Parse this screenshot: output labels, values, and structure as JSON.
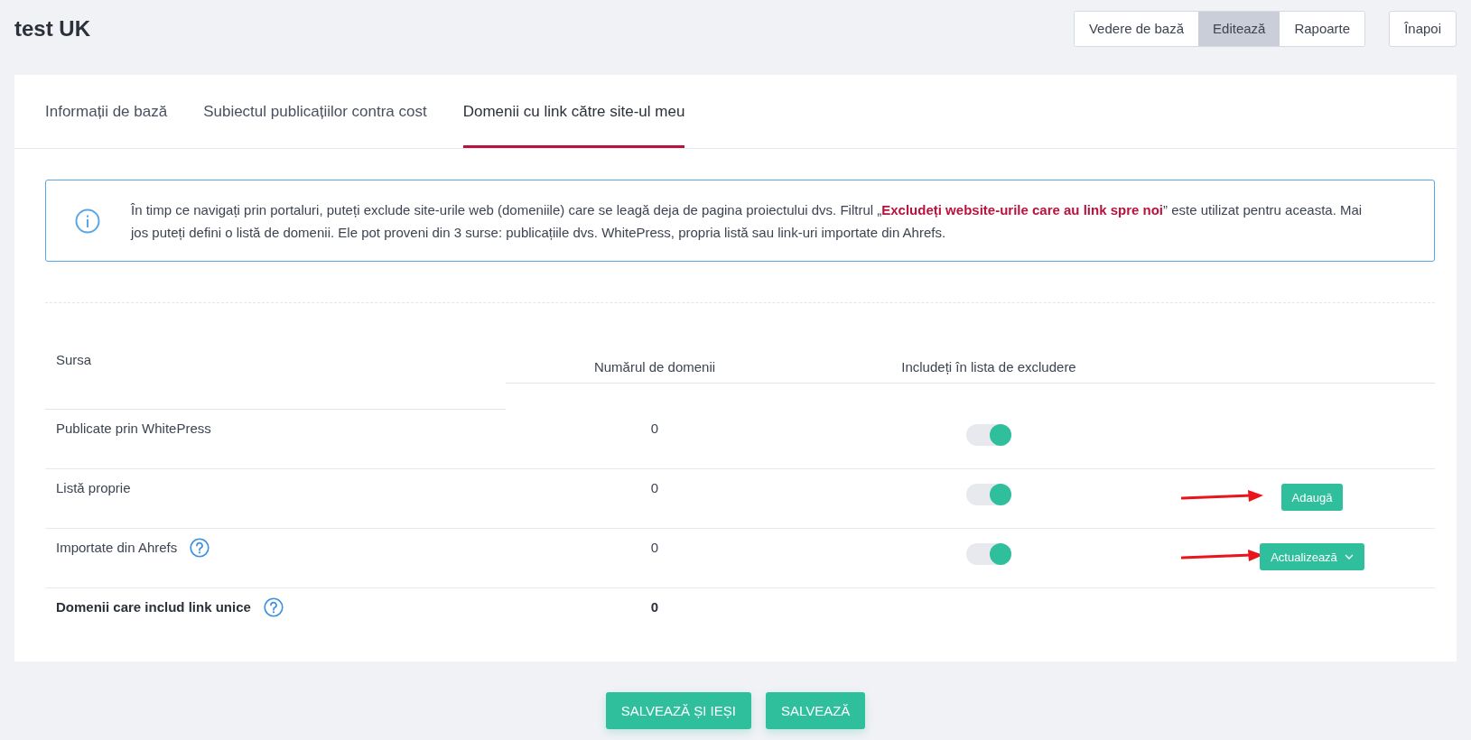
{
  "page": {
    "title": "test UK"
  },
  "view_switch": [
    {
      "label": "Vedere de bază",
      "selected": false
    },
    {
      "label": "Editează",
      "selected": true
    },
    {
      "label": "Rapoarte",
      "selected": false
    }
  ],
  "back_button": "Înapoi",
  "tabs": [
    {
      "label": "Informații de bază",
      "selected": false
    },
    {
      "label": "Subiectul publicațiilor contra cost",
      "selected": false
    },
    {
      "label": "Domenii cu link către site-ul meu",
      "selected": true
    }
  ],
  "info": {
    "text": "În timp ce navigați prin portaluri, puteți exclude site-urile web (domeniile) care se leagă deja de pagina proiectului dvs. Filtrul „**Excludeți website-urile care au link spre noi**” este utilizat pentru aceasta. Mai jos puteți defini o listă de domenii. Ele pot proveni din 3 surse: publicațiile dvs. WhitePress, propria listă sau link-uri importate din Ahrefs."
  },
  "table": {
    "columns": [
      "Sursa",
      "Numărul de domenii",
      "Includeți în lista de excludere"
    ],
    "rows": [
      {
        "kind": "source",
        "source": "Publicate prin WhitePress",
        "help": false,
        "count": "0",
        "included": true,
        "arrow": false
      },
      {
        "kind": "source",
        "source": "Listă proprie",
        "help": false,
        "count": "0",
        "included": true,
        "arrow": true,
        "action": {
          "label": "Adaugă",
          "dropdown": false
        }
      },
      {
        "kind": "source",
        "source": "Importate din Ahrefs",
        "help": true,
        "count": "0",
        "included": true,
        "arrow": true,
        "action": {
          "label": "Actualizează",
          "dropdown": true
        }
      },
      {
        "kind": "total",
        "source": "Domenii care includ link unice",
        "help": true,
        "count": "0"
      }
    ]
  },
  "footer_buttons": [
    "SALVEAZĂ ȘI IEȘI",
    "SALVEAZĂ"
  ]
}
